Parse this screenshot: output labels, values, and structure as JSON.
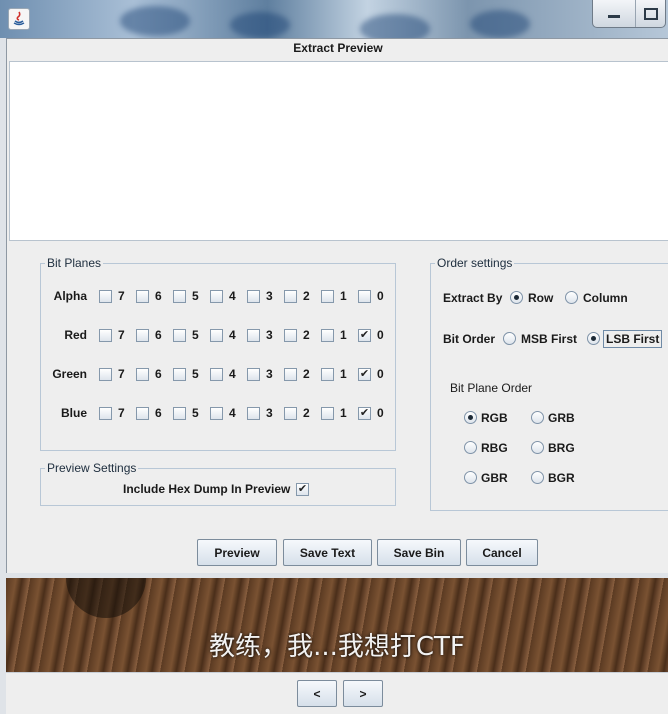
{
  "dialog": {
    "title": "Extract Preview"
  },
  "bit_planes": {
    "title": "Bit Planes",
    "bits": [
      "7",
      "6",
      "5",
      "4",
      "3",
      "2",
      "1",
      "0"
    ],
    "rows": [
      {
        "label": "Alpha",
        "checked": [
          false,
          false,
          false,
          false,
          false,
          false,
          false,
          false
        ]
      },
      {
        "label": "Red",
        "checked": [
          false,
          false,
          false,
          false,
          false,
          false,
          false,
          true
        ]
      },
      {
        "label": "Green",
        "checked": [
          false,
          false,
          false,
          false,
          false,
          false,
          false,
          true
        ]
      },
      {
        "label": "Blue",
        "checked": [
          false,
          false,
          false,
          false,
          false,
          false,
          false,
          true
        ]
      }
    ]
  },
  "preview_settings": {
    "title": "Preview Settings",
    "hex_dump_label": "Include Hex Dump In Preview",
    "hex_dump_checked": true
  },
  "order_settings": {
    "title": "Order settings",
    "extract_by_label": "Extract By",
    "extract_by_options": [
      {
        "label": "Row",
        "selected": true
      },
      {
        "label": "Column",
        "selected": false
      }
    ],
    "bit_order_label": "Bit Order",
    "bit_order_options": [
      {
        "label": "MSB First",
        "selected": false
      },
      {
        "label": "LSB First",
        "selected": true
      }
    ],
    "bit_plane_order_title": "Bit Plane Order",
    "bit_plane_order_options": [
      {
        "label": "RGB",
        "selected": true
      },
      {
        "label": "GRB",
        "selected": false
      },
      {
        "label": "RBG",
        "selected": false
      },
      {
        "label": "BRG",
        "selected": false
      },
      {
        "label": "GBR",
        "selected": false
      },
      {
        "label": "BGR",
        "selected": false
      }
    ]
  },
  "buttons": {
    "preview": "Preview",
    "save_text": "Save Text",
    "save_bin": "Save Bin",
    "cancel": "Cancel"
  },
  "background_image": {
    "caption": "教练，我...我想打CTF"
  },
  "nav": {
    "prev": "<",
    "next": ">"
  },
  "check_glyph": "✔"
}
